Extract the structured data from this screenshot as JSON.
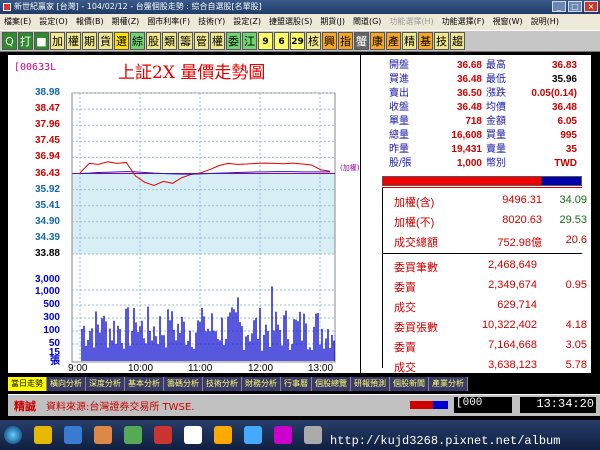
{
  "window": {
    "title": "新世紀贏家 [台灣] - 104/02/12 - 台盤個股走勢 : 綜合自選股[名單股]"
  },
  "menu": [
    "檔案(E)",
    "設定(O)",
    "報價(B)",
    "期權(Z)",
    "國市利率(F)",
    "技術(Y)",
    "設定(Z)",
    "捷盟選股(S)",
    "期貨(J)",
    "閘道(G)",
    "功能選擇(H)",
    "功能選擇(F)",
    "視窗(W)",
    "說明(H)"
  ],
  "toolbar": [
    "Q",
    "打",
    "■",
    "加",
    "權",
    "期",
    "貨",
    "選",
    "綜",
    "股",
    "類",
    "籌",
    "管",
    "權",
    "委",
    "江",
    "9",
    "6",
    "29",
    "核",
    "興",
    "指",
    "蟹",
    "康",
    "產",
    "精",
    "基",
    "技",
    "趨"
  ],
  "chart": {
    "code": "[00633L",
    "title": "上証2X  量價走勢圖",
    "price_ticks": [
      "38.98",
      "38.47",
      "37.96",
      "37.45",
      "36.94",
      "36.43",
      "35.92",
      "35.41",
      "34.90",
      "34.39",
      "33.88"
    ],
    "price_tick_colors": [
      "#16a",
      "#c00",
      "#c00",
      "#c00",
      "#c00",
      "#c00",
      "#16a",
      "#16a",
      "#16a",
      "#16a",
      "#000"
    ],
    "ref_label": "(加權)",
    "vol_ticks": [
      "3,000",
      "1,000",
      "500",
      "300",
      "100",
      "50",
      "15"
    ],
    "vol_unit": "張",
    "x_ticks": [
      "9:00",
      "10:00",
      "11:00",
      "12:00",
      "13:00"
    ]
  },
  "chart_data": {
    "type": "line",
    "title": "上証2X  量價走勢圖",
    "ylim": [
      33.88,
      38.98
    ],
    "ref_price": 36.43,
    "x": [
      "9:00",
      "9:10",
      "9:20",
      "9:30",
      "9:40",
      "9:50",
      "10:00",
      "10:10",
      "10:20",
      "10:30",
      "10:40",
      "10:50",
      "11:00",
      "11:10",
      "11:20",
      "11:30",
      "11:40",
      "11:50",
      "12:00",
      "12:10",
      "12:20",
      "12:30",
      "12:40",
      "12:50",
      "13:00",
      "13:10",
      "13:20",
      "13:30"
    ],
    "series": [
      {
        "values": [
          36.45,
          36.75,
          36.72,
          36.8,
          36.75,
          36.78,
          36.35,
          36.15,
          36.05,
          36.18,
          36.12,
          36.3,
          36.4,
          36.45,
          36.55,
          36.68,
          36.75,
          36.72,
          36.73,
          36.75,
          36.76,
          36.75,
          36.74,
          36.76,
          36.73,
          36.7,
          36.55,
          36.5
        ]
      },
      {
        "values": [
          36.43,
          36.44,
          36.46,
          36.47,
          36.48,
          36.49,
          36.48,
          36.46,
          36.44,
          36.43,
          36.42,
          36.41,
          36.41,
          36.42,
          36.43,
          36.44,
          36.45,
          36.46,
          36.47,
          36.48,
          36.48,
          36.49,
          36.49,
          36.49,
          36.48,
          36.48,
          36.48,
          36.48
        ]
      }
    ]
  },
  "quote": {
    "rows": [
      {
        "l1": "開盤",
        "v1": "36.68",
        "l2": "最高",
        "v2": "36.83",
        "c1": "#c00",
        "c2": "#c00"
      },
      {
        "l1": "買進",
        "v1": "36.48",
        "l2": "最低",
        "v2": "35.96",
        "c1": "#c00",
        "c2": "#000"
      },
      {
        "l1": "賣出",
        "v1": "36.50",
        "l2": "漲跌",
        "v2": "0.05(0.14)",
        "c1": "#c00",
        "c2": "#c00"
      },
      {
        "l1": "收盤",
        "v1": "36.48",
        "l2": "均價",
        "v2": "36.48",
        "c1": "#c00",
        "c2": "#c00"
      },
      {
        "l1": "單量",
        "v1": "718",
        "l2": "金額",
        "v2": "6.05",
        "c1": "#c00",
        "c2": "#c00"
      },
      {
        "l1": "總量",
        "v1": "16,608",
        "l2": "買量",
        "v2": "995",
        "c1": "#c00",
        "c2": "#c00"
      },
      {
        "l1": "昨量",
        "v1": "19,431",
        "l2": "賣量",
        "v2": "35",
        "c1": "#c00",
        "c2": "#c00"
      },
      {
        "l1": "股/張",
        "v1": "1,000",
        "l2": "幣別",
        "v2": "TWD",
        "c1": "#c00",
        "c2": "#c00"
      }
    ],
    "index": [
      {
        "label": "加權(含)",
        "value": "9496.31",
        "chg": "34.09",
        "cc": "#1a6b1a"
      },
      {
        "label": "加權(不)",
        "value": "8020.63",
        "chg": "29.53",
        "cc": "#1a6b1a"
      },
      {
        "label": "成交總額",
        "value": "752.98億",
        "chg": "20.6",
        "cc": "#c00"
      }
    ],
    "orders": [
      {
        "label": "委買筆數",
        "value": "2,468,649",
        "chg": ""
      },
      {
        "label": "委賣",
        "value": "2,349,674",
        "chg": "0.95"
      },
      {
        "label": "成交",
        "value": "629,714",
        "chg": ""
      },
      {
        "label": "委買張數",
        "value": "10,322,402",
        "chg": "4.18"
      },
      {
        "label": "委賣",
        "value": "7,164,668",
        "chg": "3.05"
      },
      {
        "label": "成交",
        "value": "3,638,123",
        "chg": "5.78"
      }
    ]
  },
  "tabs": [
    "當日走勢",
    "橫向分析",
    "深度分析",
    "基本分析",
    "籌碼分析",
    "技術分析",
    "財務分析",
    "行事曆",
    "個股總覽",
    "研報預測",
    "個股新聞",
    "產業分析"
  ],
  "status": {
    "label": "精誠",
    "source": "資料來源:台灣證券交易所 TWSE.",
    "code": "[000",
    "time": "13:34:20"
  },
  "watermark": "http://kujd3268.pixnet.net/album",
  "colors": {
    "up": "#c00",
    "panel_bg": "#fff",
    "accent": "#ffff00"
  }
}
